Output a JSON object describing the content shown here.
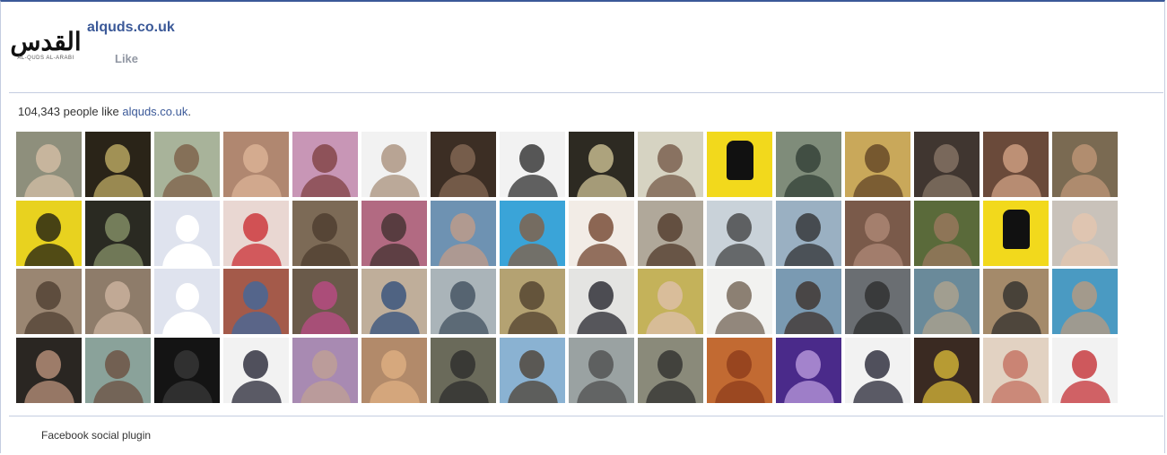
{
  "page": {
    "name": "alquds.co.uk",
    "logo_text": "القدس",
    "logo_sub": "AL-QUDS AL-ARABI",
    "like_label": "Like"
  },
  "stats": {
    "count_text": "104,343 people like ",
    "page_link": "alquds.co.uk",
    "count_suffix": "."
  },
  "footer": {
    "label": "Facebook social plugin"
  },
  "colors": {
    "brand": "#3b5998",
    "divider": "#c4cde0",
    "like": "#9197a3"
  },
  "faces": [
    {
      "kind": "photo",
      "bg": "#8e8f7c",
      "fg": "#d9c2a8"
    },
    {
      "kind": "photo",
      "bg": "#2a2418",
      "fg": "#c9b56a"
    },
    {
      "kind": "photo",
      "bg": "#a8b39a",
      "fg": "#7a5a42"
    },
    {
      "kind": "photo",
      "bg": "#b08770",
      "fg": "#e0b79a"
    },
    {
      "kind": "photo",
      "bg": "#c896b6",
      "fg": "#7b3b3a"
    },
    {
      "kind": "photo",
      "bg": "#f2f2f2",
      "fg": "#a48a74"
    },
    {
      "kind": "photo",
      "bg": "#3c2e24",
      "fg": "#8a6e58"
    },
    {
      "kind": "photo",
      "bg": "#f2f2f2",
      "fg": "#222222"
    },
    {
      "kind": "photo",
      "bg": "#2d2a22",
      "fg": "#d8cc9c"
    },
    {
      "kind": "photo",
      "bg": "#d6d3c2",
      "fg": "#6f5240"
    },
    {
      "kind": "hand"
    },
    {
      "kind": "photo",
      "bg": "#7f8c7a",
      "fg": "#2c3a32"
    },
    {
      "kind": "photo",
      "bg": "#c9a85a",
      "fg": "#5a3d22"
    },
    {
      "kind": "photo",
      "bg": "#403630",
      "fg": "#8c7a6a"
    },
    {
      "kind": "photo",
      "bg": "#6a4a3a",
      "fg": "#d9a88a"
    },
    {
      "kind": "photo",
      "bg": "#7a6a52",
      "fg": "#c49a7a"
    },
    {
      "kind": "photo",
      "bg": "#e8d21f",
      "fg": "#111111"
    },
    {
      "kind": "photo",
      "bg": "#2a2a22",
      "fg": "#8e9a6e"
    },
    {
      "kind": "silhouette"
    },
    {
      "kind": "photo",
      "bg": "#e9d7d2",
      "fg": "#c8242a"
    },
    {
      "kind": "photo",
      "bg": "#7c6a56",
      "fg": "#4a3a2c"
    },
    {
      "kind": "photo",
      "bg": "#b26a82",
      "fg": "#3a2e2a"
    },
    {
      "kind": "photo",
      "bg": "#6e92b2",
      "fg": "#c89c84"
    },
    {
      "kind": "photo",
      "bg": "#3aa4d8",
      "fg": "#8a5a3a"
    },
    {
      "kind": "photo",
      "bg": "#f2ece6",
      "fg": "#6a3a22"
    },
    {
      "kind": "photo",
      "bg": "#b0a89a",
      "fg": "#4a3222"
    },
    {
      "kind": "photo",
      "bg": "#c9d2d9",
      "fg": "#3a3a3a"
    },
    {
      "kind": "photo",
      "bg": "#9ab0c2",
      "fg": "#2a2a2a"
    },
    {
      "kind": "photo",
      "bg": "#7a5a4a",
      "fg": "#b38c7a"
    },
    {
      "kind": "photo",
      "bg": "#5a6a3a",
      "fg": "#a07a62"
    },
    {
      "kind": "hand"
    },
    {
      "kind": "photo",
      "bg": "#c9c2ba",
      "fg": "#e6c6ae"
    },
    {
      "kind": "photo",
      "bg": "#9a8672",
      "fg": "#4a3a2e"
    },
    {
      "kind": "photo",
      "bg": "#8e7c6a",
      "fg": "#d1b8a4"
    },
    {
      "kind": "silhouette"
    },
    {
      "kind": "photo",
      "bg": "#a45a4a",
      "fg": "#3a6aa2"
    },
    {
      "kind": "photo",
      "bg": "#6a5a4a",
      "fg": "#c24a8a"
    },
    {
      "kind": "photo",
      "bg": "#bfae9a",
      "fg": "#2a4a7a"
    },
    {
      "kind": "photo",
      "bg": "#aab4b9",
      "fg": "#3a4a5a"
    },
    {
      "kind": "photo",
      "bg": "#b4a272",
      "fg": "#4a3a2a"
    },
    {
      "kind": "photo",
      "bg": "#e4e4e2",
      "fg": "#1a1a22"
    },
    {
      "kind": "photo",
      "bg": "#c4b25a",
      "fg": "#e0c0b0"
    },
    {
      "kind": "photo",
      "bg": "#f2f2f0",
      "fg": "#6a5a4a"
    },
    {
      "kind": "photo",
      "bg": "#7a9ab2",
      "fg": "#3a2a22"
    },
    {
      "kind": "photo",
      "bg": "#6a6e72",
      "fg": "#2a2a2a"
    },
    {
      "kind": "photo",
      "bg": "#6a8a9a",
      "fg": "#b4a48c"
    },
    {
      "kind": "photo",
      "bg": "#a48a6a",
      "fg": "#2a2a2a"
    },
    {
      "kind": "photo",
      "bg": "#4a9ac2",
      "fg": "#c29a7a"
    },
    {
      "kind": "photo",
      "bg": "#2a2622",
      "fg": "#c49a82"
    },
    {
      "kind": "photo",
      "bg": "#8aa29a",
      "fg": "#6a4a3a"
    },
    {
      "kind": "photo",
      "bg": "#141414",
      "fg": "#3a3a3a"
    },
    {
      "kind": "photo",
      "bg": "#f2f2f2",
      "fg": "#1a1a2a"
    },
    {
      "kind": "photo",
      "bg": "#a88ab2",
      "fg": "#c2a292"
    },
    {
      "kind": "photo",
      "bg": "#b28a6a",
      "fg": "#e2b284"
    },
    {
      "kind": "photo",
      "bg": "#6a6a5a",
      "fg": "#2a2a2a"
    },
    {
      "kind": "photo",
      "bg": "#8ab2d2",
      "fg": "#4a3a2a"
    },
    {
      "kind": "photo",
      "bg": "#9aa2a2",
      "fg": "#4a4a4a"
    },
    {
      "kind": "photo",
      "bg": "#8a8a7a",
      "fg": "#2a2a2a"
    },
    {
      "kind": "photo",
      "bg": "#c26a32",
      "fg": "#8a3a1a"
    },
    {
      "kind": "photo",
      "bg": "#4a2a8a",
      "fg": "#c2a2e2"
    },
    {
      "kind": "photo",
      "bg": "#f2f2f2",
      "fg": "#1a1a2a"
    },
    {
      "kind": "photo",
      "bg": "#3a2a22",
      "fg": "#e2c23a"
    },
    {
      "kind": "photo",
      "bg": "#e2d2c2",
      "fg": "#c26a5a"
    },
    {
      "kind": "photo",
      "bg": "#f2f2f2",
      "fg": "#c2242a"
    }
  ]
}
